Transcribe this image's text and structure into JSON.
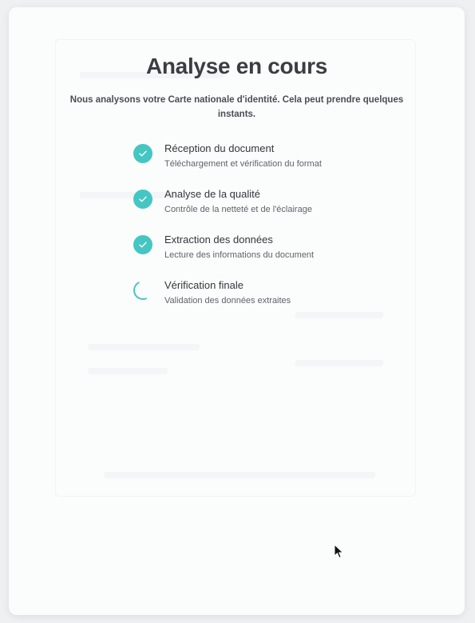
{
  "modal": {
    "title": "Analyse en cours",
    "subtitle": "Nous analysons votre Carte nationale d'identité. Cela peut prendre quelques instants."
  },
  "steps": [
    {
      "title": "Réception du document",
      "description": "Téléchargement et vérification du format",
      "status": "completed",
      "icon": "check-icon"
    },
    {
      "title": "Analyse de la qualité",
      "description": "Contrôle de la netteté et de l'éclairage",
      "status": "completed",
      "icon": "check-icon"
    },
    {
      "title": "Extraction des données",
      "description": "Lecture des informations du document",
      "status": "completed",
      "icon": "check-icon"
    },
    {
      "title": "Vérification finale",
      "description": "Validation des données extraites",
      "status": "in-progress",
      "icon": "spinner-icon"
    }
  ],
  "colors": {
    "accent": "#45c6c2",
    "title": "#3a3d42",
    "background": "#fbfcfc"
  }
}
